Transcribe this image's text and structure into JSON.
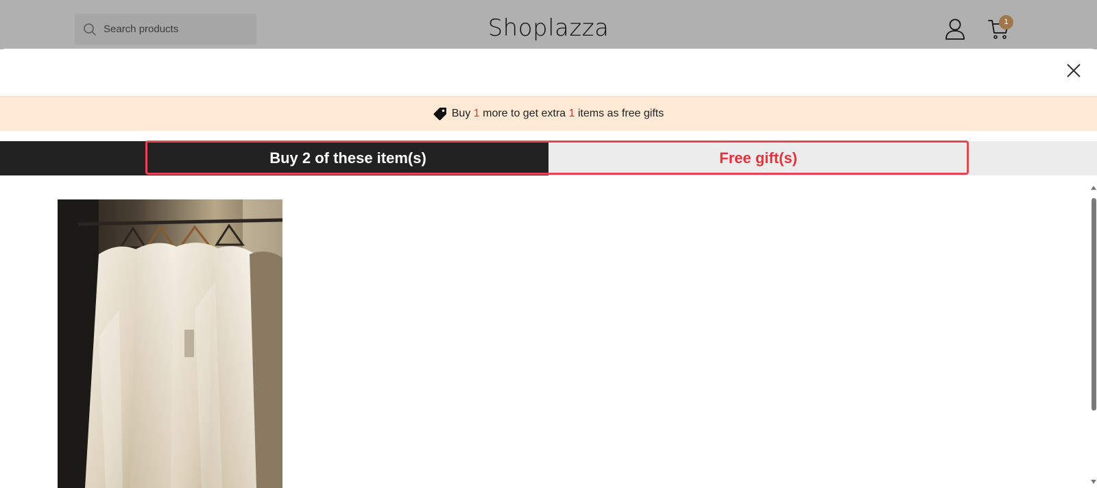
{
  "header": {
    "search_placeholder": "Search products",
    "store_name": "Shoplazza",
    "cart_count": "1",
    "icons": {
      "search": "search-icon",
      "account": "account-icon",
      "cart": "cart-icon"
    }
  },
  "modal": {
    "close_icon": "close-icon",
    "promo": {
      "icon": "tag-icon",
      "text_1": "Buy ",
      "num_1": "1",
      "text_2": " more to get extra ",
      "num_2": "1",
      "text_3": " items as free gifts"
    },
    "tabs": [
      {
        "label": "Buy 2 of these item(s)",
        "active": true
      },
      {
        "label": "Free gift(s)",
        "active": false
      }
    ],
    "product_image": "product-image-white-dresses"
  },
  "colors": {
    "accent_red": "#e3343e",
    "promo_bg": "#fde9d4",
    "tab_active_bg": "#222222",
    "tab_inactive_bg": "#ececec",
    "badge": "#a0774a"
  }
}
